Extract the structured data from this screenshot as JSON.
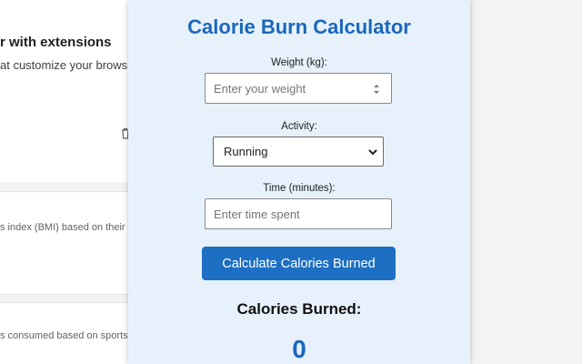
{
  "background": {
    "heading": "r with extensions",
    "subtext": "at customize your brows",
    "card1_text": "s index (BMI) based on their h",
    "card2_text": "s consumed based on sports"
  },
  "popup": {
    "title": "Calorie Burn Calculator",
    "weight": {
      "label": "Weight (kg):",
      "placeholder": "Enter your weight",
      "value": ""
    },
    "activity": {
      "label": "Activity:",
      "selected": "Running"
    },
    "time": {
      "label": "Time (minutes):",
      "placeholder": "Enter time spent",
      "value": ""
    },
    "calculate_label": "Calculate Calories Burned",
    "result_label": "Calories Burned:",
    "result_value": "0"
  },
  "icons": {
    "trash": "trash-icon",
    "spinner": "number-spinner-icon",
    "chevron": "chevron-down-icon"
  },
  "colors": {
    "accent": "#1b67bb",
    "button": "#1c6fc2",
    "popup_bg": "#e6f1fc"
  }
}
